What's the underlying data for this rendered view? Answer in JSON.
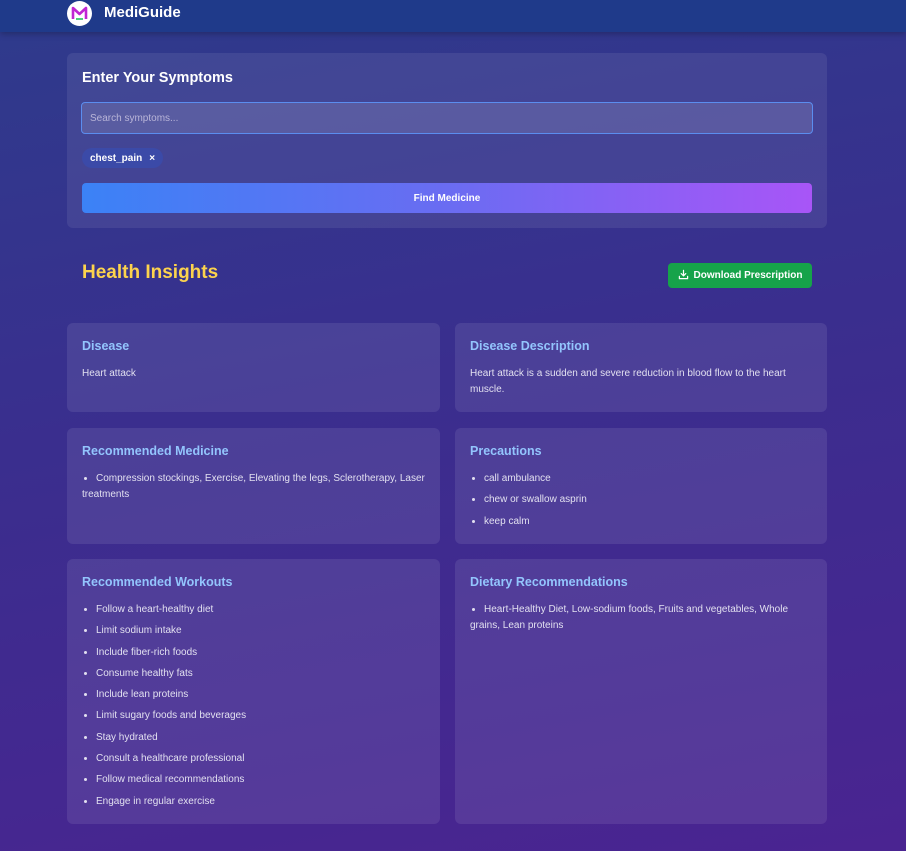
{
  "app": {
    "name": "MediGuide"
  },
  "symptoms": {
    "title": "Enter Your Symptoms",
    "placeholder": "Search symptoms...",
    "value": "",
    "selected": [
      {
        "label": "chest_pain",
        "remove": "×"
      }
    ],
    "submit_label": "Find Medicine"
  },
  "insights": {
    "title": "Health Insights",
    "download_label": "Download Prescription",
    "disease": {
      "title": "Disease",
      "text": "Heart attack"
    },
    "description": {
      "title": "Disease Description",
      "text": "Heart attack is a sudden and severe reduction in blood flow to the heart muscle."
    },
    "medicine": {
      "title": "Recommended Medicine",
      "items": [
        "Compression stockings, Exercise, Elevating the legs, Sclerotherapy, Laser treatments"
      ]
    },
    "precautions": {
      "title": "Precautions",
      "items": [
        "call ambulance",
        "chew or swallow asprin",
        "keep calm"
      ]
    },
    "workouts": {
      "title": "Recommended Workouts",
      "items": [
        "Follow a heart-healthy diet",
        "Limit sodium intake",
        "Include fiber-rich foods",
        "Consume healthy fats",
        "Include lean proteins",
        "Limit sugary foods and beverages",
        "Stay hydrated",
        "Consult a healthcare professional",
        "Follow medical recommendations",
        "Engage in regular exercise"
      ]
    },
    "diet": {
      "title": "Dietary Recommendations",
      "items": [
        "Heart-Healthy Diet, Low-sodium foods, Fruits and vegetables, Whole grains, Lean proteins"
      ]
    }
  },
  "colors": {
    "accent_yellow": "#fcd34d",
    "card_title_blue": "#93c5fd",
    "download_green": "#16a34a",
    "navbar": "#1f3a8a"
  },
  "icons": {
    "logo": "mediguide-logo-icon",
    "download": "download-icon",
    "remove_chip": "close-icon"
  }
}
